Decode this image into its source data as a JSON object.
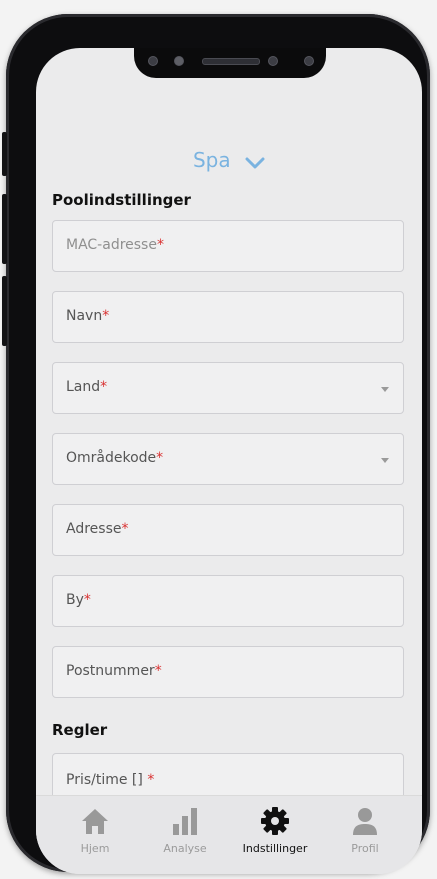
{
  "header": {
    "title": "Spa"
  },
  "sections": {
    "pool_settings": "Poolindstillinger",
    "rules": "Regler"
  },
  "fields": [
    {
      "label": "MAC-adresse",
      "required": "*"
    },
    {
      "label": "Navn",
      "required": "*"
    },
    {
      "label": "Land",
      "required": "*"
    },
    {
      "label": "Områdekode",
      "required": "*"
    },
    {
      "label": "Adresse",
      "required": "*"
    },
    {
      "label": "By",
      "required": "*"
    },
    {
      "label": "Postnummer",
      "required": "*"
    },
    {
      "label": "Pris/time [] ",
      "required": "*"
    }
  ],
  "tabs": [
    {
      "label": "Hjem",
      "icon": "home-icon"
    },
    {
      "label": "Analyse",
      "icon": "bar-chart-icon"
    },
    {
      "label": "Indstillinger",
      "icon": "gear-icon"
    },
    {
      "label": "Profil",
      "icon": "user-icon"
    }
  ],
  "colors": {
    "accent": "#7ab3e0",
    "required": "#d93131",
    "active_tab": "#111111",
    "inactive_tab": "#9b9b9b"
  }
}
